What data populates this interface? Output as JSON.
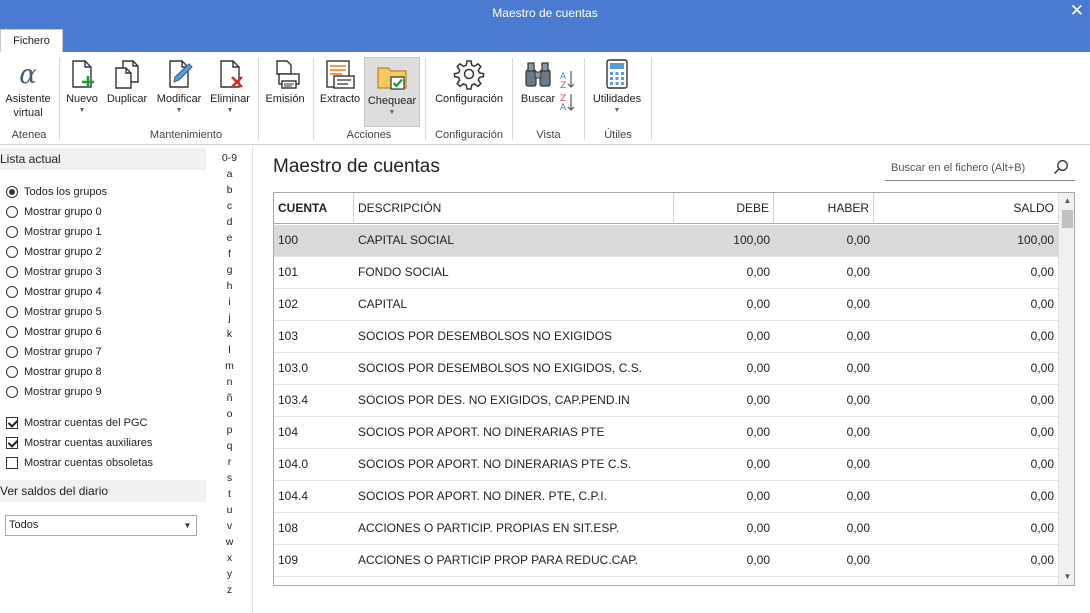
{
  "window": {
    "title": "Maestro de cuentas",
    "close": "✕"
  },
  "tabs": {
    "file": "Fichero"
  },
  "ribbon": {
    "buttons": {
      "asistente": "Asistente\nvirtual",
      "nuevo": "Nuevo",
      "duplicar": "Duplicar",
      "modificar": "Modificar",
      "eliminar": "Eliminar",
      "emision": "Emisión",
      "extracto": "Extracto",
      "chequear": "Chequear",
      "configuracion": "Configuración",
      "buscar": "Buscar",
      "utilidades": "Utilidades"
    },
    "groups": {
      "atenea": "Atenea",
      "mantenimiento": "Mantenimiento",
      "acciones": "Acciones",
      "configuracion": "Configuración",
      "vista": "Vista",
      "utiles": "Útiles"
    }
  },
  "left": {
    "lista_actual": "Lista actual",
    "radios": [
      "Todos los grupos",
      "Mostrar grupo 0",
      "Mostrar grupo 1",
      "Mostrar grupo 2",
      "Mostrar grupo 3",
      "Mostrar grupo 4",
      "Mostrar grupo 5",
      "Mostrar grupo 6",
      "Mostrar grupo 7",
      "Mostrar grupo 8",
      "Mostrar grupo 9"
    ],
    "checks": [
      {
        "label": "Mostrar cuentas del PGC",
        "checked": true
      },
      {
        "label": "Mostrar cuentas auxiliares",
        "checked": true
      },
      {
        "label": "Mostrar cuentas obsoletas",
        "checked": false
      }
    ],
    "saldos_heading": "Ver saldos del diario",
    "saldos_select": "Todos"
  },
  "letters": [
    "0-9",
    "a",
    "b",
    "c",
    "d",
    "e",
    "f",
    "g",
    "h",
    "i",
    "j",
    "k",
    "l",
    "m",
    "n",
    "ñ",
    "o",
    "p",
    "q",
    "r",
    "s",
    "t",
    "u",
    "v",
    "w",
    "x",
    "y",
    "z"
  ],
  "main": {
    "title": "Maestro de cuentas",
    "search_placeholder": "Buscar en el fichero (Alt+B)",
    "columns": {
      "cuenta": "CUENTA",
      "descripcion": "DESCRIPCIÓN",
      "debe": "DEBE",
      "haber": "HABER",
      "saldo": "SALDO"
    },
    "rows": [
      {
        "cuenta": "100",
        "descripcion": "CAPITAL SOCIAL",
        "debe": "100,00",
        "haber": "0,00",
        "saldo": "100,00"
      },
      {
        "cuenta": "101",
        "descripcion": "FONDO SOCIAL",
        "debe": "0,00",
        "haber": "0,00",
        "saldo": "0,00"
      },
      {
        "cuenta": "102",
        "descripcion": "CAPITAL",
        "debe": "0,00",
        "haber": "0,00",
        "saldo": "0,00"
      },
      {
        "cuenta": "103",
        "descripcion": "SOCIOS POR DESEMBOLSOS NO EXIGIDOS",
        "debe": "0,00",
        "haber": "0,00",
        "saldo": "0,00"
      },
      {
        "cuenta": "103.0",
        "descripcion": "SOCIOS POR DESEMBOLSOS NO EXIGIDOS, C.S.",
        "debe": "0,00",
        "haber": "0,00",
        "saldo": "0,00"
      },
      {
        "cuenta": "103.4",
        "descripcion": "SOCIOS POR DES. NO EXIGIDOS, CAP.PEND.IN",
        "debe": "0,00",
        "haber": "0,00",
        "saldo": "0,00"
      },
      {
        "cuenta": "104",
        "descripcion": "SOCIOS POR APORT. NO DINERARIAS PTE",
        "debe": "0,00",
        "haber": "0,00",
        "saldo": "0,00"
      },
      {
        "cuenta": "104.0",
        "descripcion": "SOCIOS POR APORT. NO DINERARIAS PTE C.S.",
        "debe": "0,00",
        "haber": "0,00",
        "saldo": "0,00"
      },
      {
        "cuenta": "104.4",
        "descripcion": "SOCIOS POR APORT. NO DINER. PTE, C.P.I.",
        "debe": "0,00",
        "haber": "0,00",
        "saldo": "0,00"
      },
      {
        "cuenta": "108",
        "descripcion": "ACCIONES O PARTICIP. PROPIAS EN SIT.ESP.",
        "debe": "0,00",
        "haber": "0,00",
        "saldo": "0,00"
      },
      {
        "cuenta": "109",
        "descripcion": "ACCIONES O PARTICIP PROP PARA REDUC.CAP.",
        "debe": "0,00",
        "haber": "0,00",
        "saldo": "0,00"
      }
    ]
  }
}
